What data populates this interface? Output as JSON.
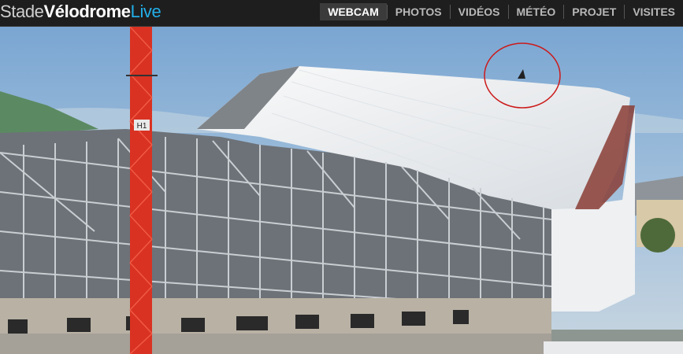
{
  "logo": {
    "part1": "Stade",
    "part2": "Vélodrome",
    "part3": "Live"
  },
  "nav": {
    "items": [
      {
        "label": "WEBCAM",
        "active": true
      },
      {
        "label": "PHOTOS"
      },
      {
        "label": "VIDÉOS"
      },
      {
        "label": "MÉTÉO"
      },
      {
        "label": "PROJET"
      },
      {
        "label": "VISITES"
      }
    ]
  },
  "webcam": {
    "crane_label": "H1"
  },
  "colors": {
    "accent": "#23aee8",
    "highlight_circle": "#cc1a1a"
  }
}
